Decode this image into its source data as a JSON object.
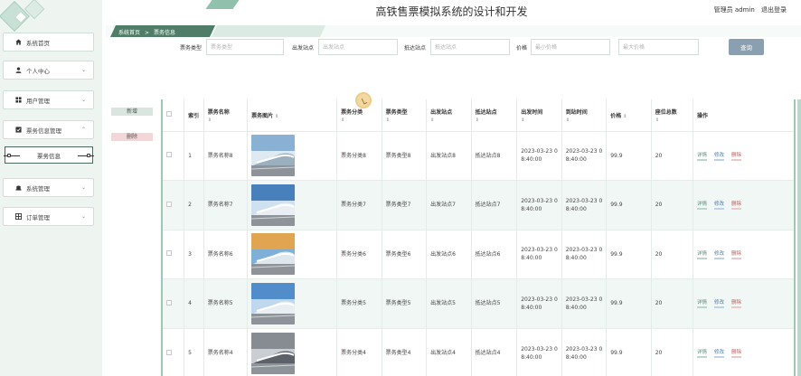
{
  "header": {
    "title": "高铁售票模拟系统的设计和开发",
    "user_role": "管理员 admin",
    "logout": "退出登录"
  },
  "sidebar": {
    "items": [
      {
        "label": "系统首页",
        "icon": "home-icon"
      },
      {
        "label": "个人中心",
        "icon": "user-icon"
      },
      {
        "label": "用户管理",
        "icon": "grid-icon"
      },
      {
        "label": "票务信息管理",
        "icon": "checkbox-icon"
      },
      {
        "label": "系统管理",
        "icon": "hat-icon"
      },
      {
        "label": "订单管理",
        "icon": "grid-icon"
      }
    ],
    "sub_item": "票务信息"
  },
  "breadcrumb": {
    "home": "系统首页",
    "separator": ">",
    "current": "票务信息"
  },
  "search": {
    "type_label": "票务类型",
    "type_placeholder": "票务类型",
    "depart_label": "出发站点",
    "depart_placeholder": "出发站点",
    "arrive_label": "抵达站点",
    "arrive_placeholder": "抵达站点",
    "price_label": "价格",
    "min_placeholder": "最小价格",
    "max_placeholder": "最大价格",
    "button": "查询"
  },
  "actions": {
    "add": "新增",
    "delete": "删除"
  },
  "table": {
    "headers": [
      "索引",
      "票务名称",
      "票务图片",
      "票务分类",
      "票务类型",
      "出发站点",
      "抵达站点",
      "出发时间",
      "到站时间",
      "价格",
      "座位总数",
      "操作"
    ],
    "operations": {
      "detail": "详情",
      "edit": "修改",
      "delete": "删除"
    },
    "rows": [
      {
        "index": "1",
        "name": "票务名称8",
        "category": "票务分类8",
        "type": "票务类型8",
        "depart": "出发站点8",
        "arrive": "抵达站点8",
        "depart_time": "2023-03-23 08:40:00",
        "arrive_time": "2023-03-23 08:40:00",
        "price": "99.9",
        "seats": "20"
      },
      {
        "index": "2",
        "name": "票务名称7",
        "category": "票务分类7",
        "type": "票务类型7",
        "depart": "出发站点7",
        "arrive": "抵达站点7",
        "depart_time": "2023-03-23 08:40:00",
        "arrive_time": "2023-03-23 08:40:00",
        "price": "99.9",
        "seats": "20"
      },
      {
        "index": "3",
        "name": "票务名称6",
        "category": "票务分类6",
        "type": "票务类型6",
        "depart": "出发站点6",
        "arrive": "抵达站点6",
        "depart_time": "2023-03-23 08:40:00",
        "arrive_time": "2023-03-23 08:40:00",
        "price": "99.9",
        "seats": "20"
      },
      {
        "index": "4",
        "name": "票务名称5",
        "category": "票务分类5",
        "type": "票务类型5",
        "depart": "出发站点5",
        "arrive": "抵达站点5",
        "depart_time": "2023-03-23 08:40:00",
        "arrive_time": "2023-03-23 08:40:00",
        "price": "99.9",
        "seats": "20"
      },
      {
        "index": "5",
        "name": "票务名称4",
        "category": "票务分类4",
        "type": "票务类型4",
        "depart": "出发站点4",
        "arrive": "抵达站点4",
        "depart_time": "2023-03-23 08:40:00",
        "arrive_time": "2023-03-23 08:40:00",
        "price": "99.9",
        "seats": "20"
      }
    ]
  },
  "colors": {
    "accent": "#4f7d68",
    "sidebar_bg": "#eef5f1",
    "row_alt": "#f1f7f4",
    "search_button": "#8a9fb0"
  }
}
